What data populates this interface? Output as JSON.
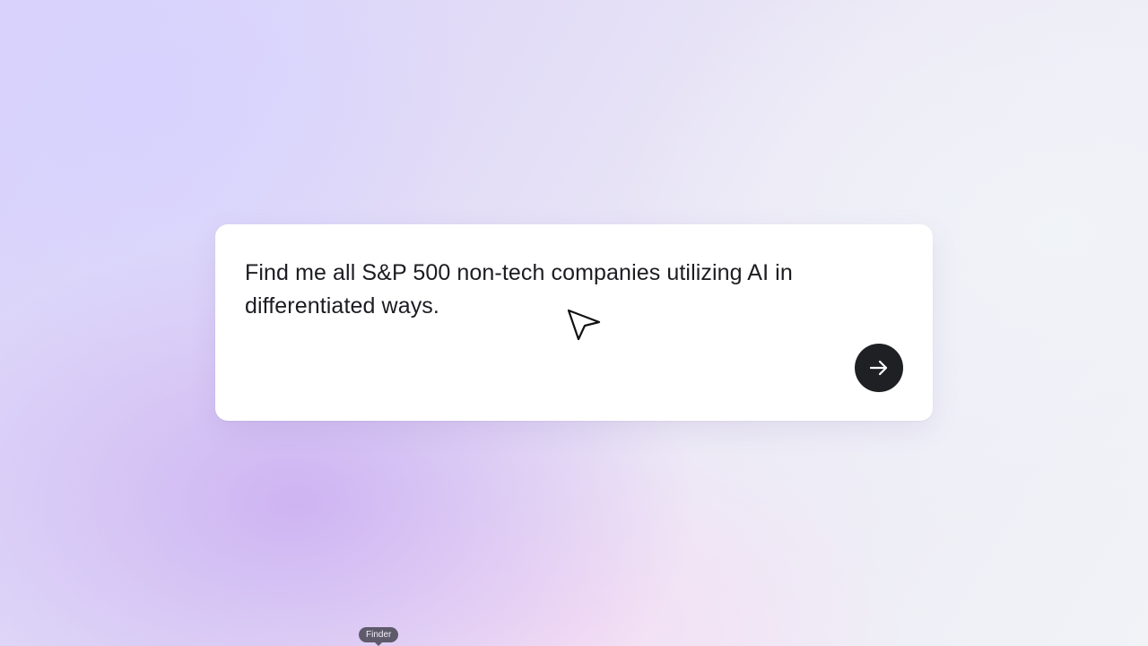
{
  "prompt": {
    "text": "Find me all S&P 500 non-tech companies utilizing AI in differentiated ways.",
    "submit_icon": "arrow-right-icon",
    "submit_button_color": "#1f2024"
  },
  "cursor": {
    "icon": "pointer-arrow-icon"
  },
  "dock": {
    "tooltip_label": "Finder"
  },
  "theme": {
    "background_colors": [
      "#d9d2fb",
      "#cdb2f2",
      "#f6dcf4",
      "#f1f3f7"
    ],
    "card_color": "#ffffff"
  }
}
